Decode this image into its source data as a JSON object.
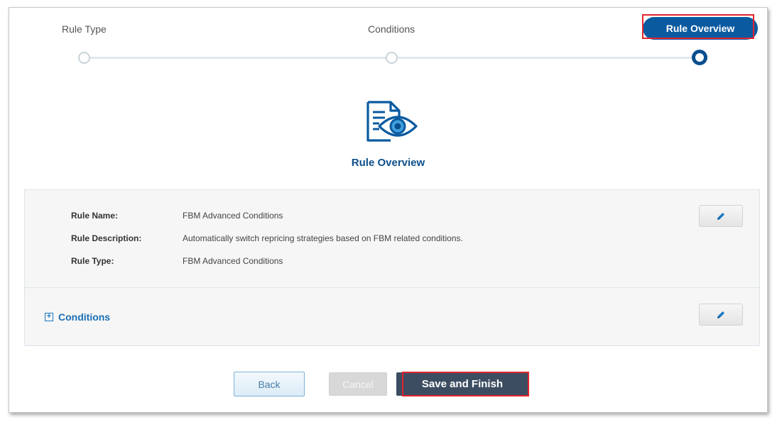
{
  "stepper": {
    "steps": [
      {
        "label": "Rule Type"
      },
      {
        "label": "Conditions"
      },
      {
        "label": "Rule Overview"
      }
    ],
    "active_step": "Rule Overview"
  },
  "overview": {
    "icon": "document-eye-icon",
    "title": "Rule Overview"
  },
  "details": {
    "rows": [
      {
        "label": "Rule Name:",
        "value": "FBM Advanced Conditions"
      },
      {
        "label": "Rule Description:",
        "value": "Automatically switch repricing strategies based on FBM related conditions."
      },
      {
        "label": "Rule Type:",
        "value": "FBM Advanced Conditions"
      }
    ],
    "edit_icon": "pencil-icon"
  },
  "conditions": {
    "label": "Conditions",
    "toggle_icon": "plus-square-icon"
  },
  "footer": {
    "back_label": "Back",
    "cancel_label": "Cancel",
    "save_label": "Save and Finish"
  },
  "colors": {
    "accent": "#0a5aa0",
    "title_blue": "#0d4f8b",
    "link_blue": "#1a6fb4",
    "save_bg": "#3d4d61",
    "highlight": "#e4232d"
  }
}
